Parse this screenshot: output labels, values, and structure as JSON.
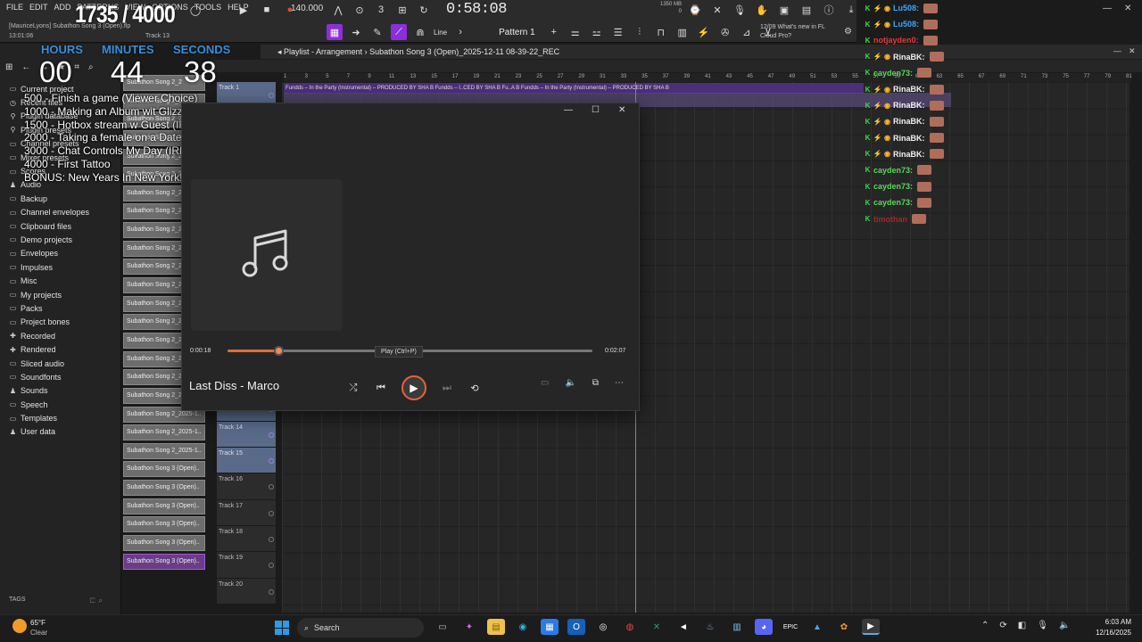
{
  "fl": {
    "menu": [
      "FILE",
      "EDIT",
      "ADD",
      "PATTERNS",
      "VIEW",
      "OPTIONS",
      "TOOLS",
      "HELP"
    ],
    "project_file": "[MauriceLyons] Subathon Song 3 (Open).flp",
    "project_time": "13:01:06",
    "track_label": "Track 13",
    "tempo": "140.000",
    "clock": "0:58:08",
    "memory": [
      "1350 MB",
      "0"
    ],
    "news_date": "12/09",
    "news_title": "What's new in FL",
    "news_sub": "Cloud Pro?",
    "line_label": "Line",
    "pattern": "Pattern 1",
    "playlist_title": "Playlist - Arrangement",
    "playlist_song": "Subathon Song 3 (Open)_2025-12-11 08-39-22_REC"
  },
  "overlay": {
    "goal_count": "1735 / 4000",
    "labels": [
      "HOURS",
      "MINUTES",
      "SECONDS"
    ],
    "digits": [
      "00",
      "44",
      "38"
    ],
    "goals": [
      "500 - Finish a game (Viewer Choice)",
      "1000 - Making an Album wit GlizzyGio (Desktop)",
      "1500 - Hotbox stream w Guest (IRL Miami)",
      "2000 - Taking a female on a Date (IRL Miami)",
      "3000 - Chat Controls My Day (IRL Miami)",
      "4000 - First Tattoo",
      "BONUS: New Years In New York!"
    ]
  },
  "browser": {
    "items": [
      {
        "icon": "folder",
        "label": "Current project"
      },
      {
        "icon": "clock",
        "label": "Recent files"
      },
      {
        "icon": "plug",
        "label": "Plugin database"
      },
      {
        "icon": "plug",
        "label": "Plugin presets"
      },
      {
        "icon": "folder",
        "label": "Channel presets"
      },
      {
        "icon": "folder",
        "label": "Mixer presets"
      },
      {
        "icon": "folder",
        "label": "Scores"
      },
      {
        "icon": "person",
        "label": "Audio"
      },
      {
        "icon": "folder",
        "label": "Backup"
      },
      {
        "icon": "folder",
        "label": "Channel envelopes"
      },
      {
        "icon": "folder",
        "label": "Clipboard files"
      },
      {
        "icon": "folder",
        "label": "Demo projects"
      },
      {
        "icon": "folder",
        "label": "Envelopes"
      },
      {
        "icon": "folder",
        "label": "Impulses"
      },
      {
        "icon": "folder",
        "label": "Misc"
      },
      {
        "icon": "folder",
        "label": "My projects"
      },
      {
        "icon": "folder",
        "label": "Packs"
      },
      {
        "icon": "folder",
        "label": "Project bones"
      },
      {
        "icon": "plus",
        "label": "Recorded"
      },
      {
        "icon": "plus",
        "label": "Rendered"
      },
      {
        "icon": "folder",
        "label": "Sliced audio"
      },
      {
        "icon": "folder",
        "label": "Soundfonts"
      },
      {
        "icon": "person",
        "label": "Sounds"
      },
      {
        "icon": "folder",
        "label": "Speech"
      },
      {
        "icon": "folder",
        "label": "Templates"
      },
      {
        "icon": "person",
        "label": "User data"
      }
    ],
    "tags_label": "TAGS"
  },
  "clips": [
    "Subathon Song 2_2",
    "Subathon Song 2_2",
    "Subathon Song 2_2",
    "Subathon Song 2_2",
    "Subathon Song 2_2",
    "Subathon Song 2_2",
    "Subathon Song 2_2",
    "Subathon Song 2_2",
    "Subathon Song 2_2",
    "Subathon Song 2_2",
    "Subathon Song 2_2",
    "Subathon Song 2_2",
    "Subathon Song 2_2",
    "Subathon Song 2_2",
    "Subathon Song 2_2",
    "Subathon Song 2_2",
    "Subathon Song 2_2025-1..",
    "Subathon Song 2_2025-1..",
    "Subathon Song 2_2025-1..",
    "Subathon Song 2_2025-1..",
    "Subathon Song 2_2025-1..",
    "Subathon Song 3 (Open)..",
    "Subathon Song 3 (Open)..",
    "Subathon Song 3 (Open)..",
    "Subathon Song 3 (Open)..",
    "Subathon Song 3 (Open)..",
    "Subathon Song 3 (Open).."
  ],
  "tracks": [
    {
      "label": "Track 1",
      "blue": true
    },
    {
      "label": "",
      "blue": true
    },
    {
      "label": "",
      "blue": true
    },
    {
      "label": "",
      "blue": true
    },
    {
      "label": "",
      "blue": true
    },
    {
      "label": "",
      "blue": true
    },
    {
      "label": "",
      "blue": true
    },
    {
      "label": "",
      "blue": true
    },
    {
      "label": "",
      "blue": true
    },
    {
      "label": "",
      "blue": true
    },
    {
      "label": "",
      "blue": true
    },
    {
      "label": "",
      "blue": true
    },
    {
      "label": "",
      "blue": true
    },
    {
      "label": "Track 14",
      "blue": true
    },
    {
      "label": "Track 15",
      "blue": true
    },
    {
      "label": "Track 16",
      "blue": false
    },
    {
      "label": "Track 17",
      "blue": false
    },
    {
      "label": "Track 18",
      "blue": false
    },
    {
      "label": "Track 19",
      "blue": false
    },
    {
      "label": "Track 20",
      "blue": false
    }
  ],
  "ruler": [
    "1",
    "3",
    "5",
    "7",
    "9",
    "11",
    "13",
    "15",
    "17",
    "19",
    "21",
    "23",
    "25",
    "27",
    "29",
    "31",
    "33",
    "35",
    "37",
    "39",
    "41",
    "43",
    "45",
    "47",
    "49",
    "51",
    "53",
    "55",
    "57",
    "59",
    "61",
    "63",
    "65",
    "67",
    "69",
    "71",
    "73",
    "75",
    "77",
    "79",
    "81"
  ],
  "audio_clip_text": "Fundds – In the Party (Instrumental) – PRODUCED BY SHA B    Fundds – I..CED BY SHA B    Fu..A B    Fundds – In the Party (Instrumental) – PRODUCED BY SHA B",
  "chat": [
    {
      "user": "Lu508:",
      "color": "#3aa8f8",
      "badges": [
        "green",
        "blue",
        "gold"
      ]
    },
    {
      "user": "Lu508:",
      "color": "#3aa8f8",
      "badges": [
        "green",
        "blue",
        "gold"
      ]
    },
    {
      "user": "notjayden0:",
      "color": "#e03a3a",
      "badges": [
        "green"
      ]
    },
    {
      "user": "RinaBK:",
      "color": "#f0f0f0",
      "badges": [
        "green",
        "blue",
        "gold"
      ]
    },
    {
      "user": "cayden73:",
      "color": "#5ad85a",
      "badges": [
        "green"
      ]
    },
    {
      "user": "RinaBK:",
      "color": "#f0f0f0",
      "badges": [
        "green",
        "blue",
        "gold"
      ]
    },
    {
      "user": "RinaBK:",
      "color": "#f0f0f0",
      "badges": [
        "green",
        "blue",
        "gold"
      ]
    },
    {
      "user": "RinaBK:",
      "color": "#f0f0f0",
      "badges": [
        "green",
        "blue",
        "gold"
      ]
    },
    {
      "user": "RinaBK:",
      "color": "#f0f0f0",
      "badges": [
        "green",
        "blue",
        "gold"
      ]
    },
    {
      "user": "RinaBK:",
      "color": "#f0f0f0",
      "badges": [
        "green",
        "blue",
        "gold"
      ]
    },
    {
      "user": "cayden73:",
      "color": "#5ad85a",
      "badges": [
        "green"
      ]
    },
    {
      "user": "cayden73:",
      "color": "#5ad85a",
      "badges": [
        "green"
      ]
    },
    {
      "user": "cayden73:",
      "color": "#5ad85a",
      "badges": [
        "green"
      ]
    },
    {
      "user": "timothan",
      "color": "#a02828",
      "badges": [
        "green"
      ]
    }
  ],
  "player": {
    "time_current": "0:00:18",
    "time_total": "0:02:07",
    "progress": 0.14,
    "tooltip": "Play (Ctrl+P)",
    "song_title": "Last Diss - Marco",
    "accent": "#e2633f"
  },
  "taskbar": {
    "temp": "65°F",
    "condition": "Clear",
    "search_placeholder": "Search",
    "time": "6:03 AM",
    "date": "12/16/2025"
  }
}
